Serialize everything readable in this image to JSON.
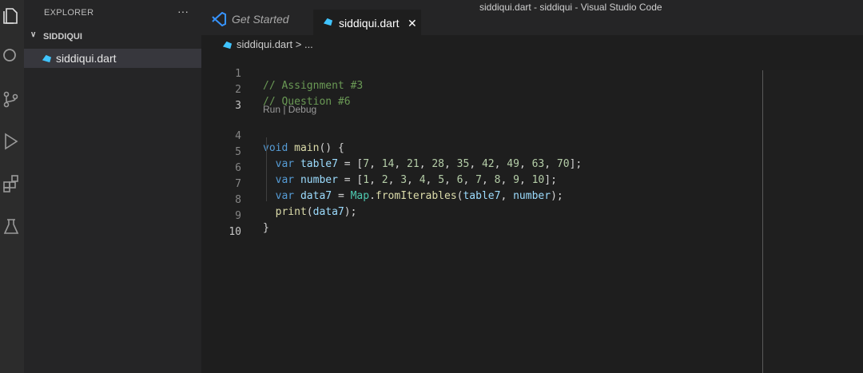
{
  "window": {
    "title": "siddiqui.dart - siddiqui - Visual Studio Code"
  },
  "activity_bar": {
    "icons": [
      "explorer-icon",
      "search-icon",
      "source-control-icon",
      "run-debug-icon",
      "extensions-icon",
      "testing-icon"
    ]
  },
  "sidebar": {
    "title": "EXPLORER",
    "more": "···",
    "folder": {
      "name": "SIDDIQUI",
      "expanded": true
    },
    "files": [
      {
        "name": "siddiqui.dart",
        "selected": true
      }
    ]
  },
  "tabs": [
    {
      "label": "Get Started",
      "active": false
    },
    {
      "label": "siddiqui.dart",
      "active": true,
      "close": "✕"
    }
  ],
  "breadcrumb": {
    "file": "siddiqui.dart",
    "separator": ">",
    "trail": "..."
  },
  "editor": {
    "codelens": "Run | Debug",
    "line_numbers": [
      "1",
      "2",
      "3",
      "4",
      "5",
      "6",
      "7",
      "8",
      "9",
      "10"
    ],
    "lines": [
      "// Assignment #3",
      "// Question #6",
      "",
      "void main() {",
      "  var table7 = [7, 14, 21, 28, 35, 42, 49, 63, 70];",
      "  var number = [1, 2, 3, 4, 5, 6, 7, 8, 9, 10];",
      "  var data7 = Map.fromIterables(table7, number);",
      "  print(data7);",
      "}",
      ""
    ]
  },
  "colors": {
    "editor_bg": "#1e1e1e",
    "sidebar_bg": "#252526",
    "activity_bg": "#2c2c2c",
    "comment": "#6a9955",
    "keyword": "#569cd6",
    "function": "#dcdcaa",
    "variable": "#9cdcfe",
    "type": "#4ec9b0",
    "number": "#b5cea8",
    "dart_icon": "#40c4ff",
    "vscode_icon": "#3794ff"
  }
}
